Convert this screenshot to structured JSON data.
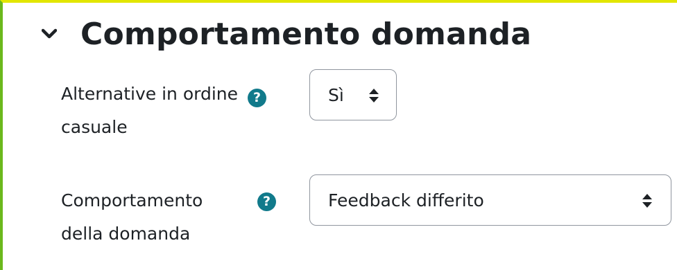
{
  "section": {
    "title": "Comportamento domanda",
    "collapse_icon": "chevron-down-icon"
  },
  "fields": [
    {
      "label_line1": "Alternative in ordine",
      "label_line2": "casuale",
      "help_icon": "question-circle-icon",
      "help_glyph": "?",
      "value": "Sì",
      "select_icon": "sort-arrows-icon"
    },
    {
      "label_line1": "Comportamento",
      "label_line2": "della domanda",
      "help_icon": "question-circle-icon",
      "help_glyph": "?",
      "value": "Feedback differito",
      "select_icon": "sort-arrows-icon"
    }
  ],
  "colors": {
    "text": "#1d2125",
    "help_icon": "#117a8b",
    "select_border": "#8f959e",
    "frame_top": "#e2e600",
    "frame_left": "#6bb81c"
  }
}
